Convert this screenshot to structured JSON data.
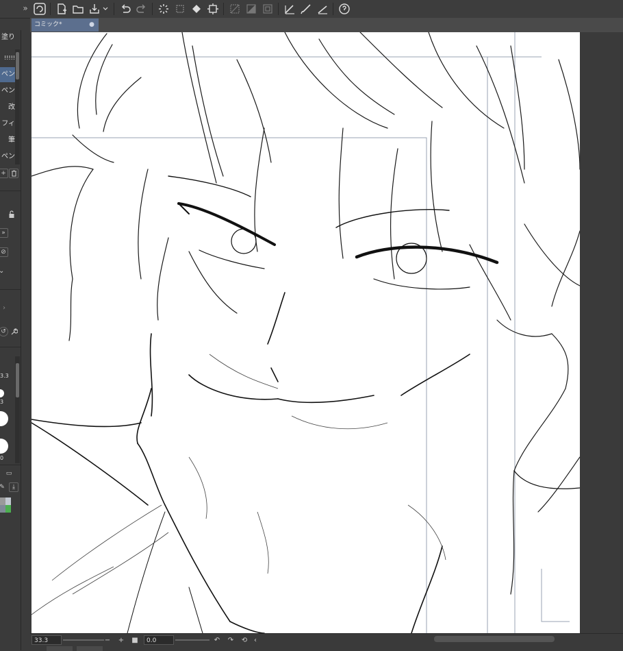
{
  "toolbar": {
    "collapse_label": "»",
    "icons": [
      "app-logo-icon",
      "new-file-icon",
      "open-file-icon",
      "save-icon",
      "chevron-down-icon",
      "undo-icon",
      "redo-icon",
      "loading-icon",
      "transform-icon",
      "fill-icon",
      "crop-icon",
      "clear-selection-icon",
      "invert-selection-icon",
      "select-all-icon",
      "pen-tool-icon",
      "brush-tool-icon",
      "ruler-tool-icon",
      "help-icon"
    ]
  },
  "document_tab": {
    "title": "コミック*",
    "modified_marker": "●"
  },
  "left_panel": {
    "tool_items": [
      "塗り",
      "!!!!!",
      "ペン",
      "ペン",
      "改",
      "フィ",
      "筆",
      "ペン"
    ],
    "values": [
      "3.3",
      "3",
      "0"
    ]
  },
  "status_bar": {
    "zoom_value": "33.3",
    "zoom_out": "−",
    "zoom_in": "+",
    "angle_value": "0.0",
    "collapse": "‹"
  },
  "colors": {
    "accent": "#5c6f8e",
    "selected": "#4f6a8f",
    "ui_bg": "#3b3b3b",
    "canvas": "#ffffff"
  }
}
